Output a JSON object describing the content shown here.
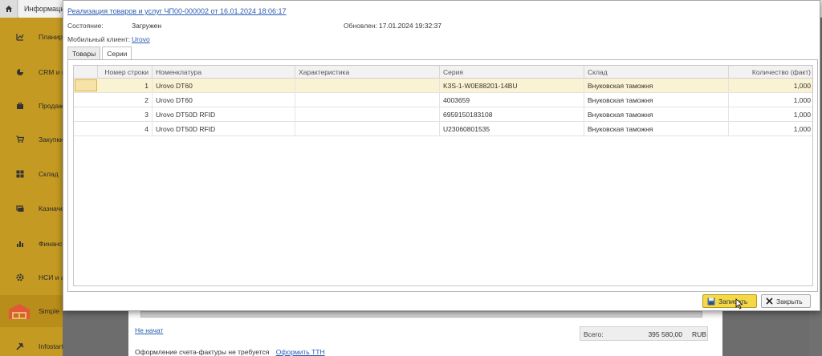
{
  "app": {
    "top_tab": "Информационная"
  },
  "sidebar": {
    "items": [
      {
        "label": "Планирование",
        "icon": "chart-edit-icon"
      },
      {
        "label": "CRM и маркетинг",
        "icon": "pie-chart-icon"
      },
      {
        "label": "Продажи",
        "icon": "briefcase-icon"
      },
      {
        "label": "Закупки",
        "icon": "cart-icon"
      },
      {
        "label": "Склад",
        "icon": "grid-icon"
      },
      {
        "label": "Казначейство",
        "icon": "money-icon"
      },
      {
        "label": "Финансовый контроль",
        "icon": "bar-chart-icon"
      },
      {
        "label": "НСИ и администрирование",
        "icon": "gear-icon"
      },
      {
        "label": "Simple",
        "icon": "warehouse-icon"
      },
      {
        "label": "Infostart Toolkit",
        "icon": "tools-icon"
      }
    ]
  },
  "modal": {
    "title": "Реализация товаров и услуг ЧП00-000002 от 16.01.2024 18:06:17",
    "state_label": "Состояние:",
    "state_value": "Загружен",
    "updated_label": "Обновлен:",
    "updated_value": "17.01.2024 19:32:37",
    "client_label": "Мобильный клиент:",
    "client_value": "Urovo",
    "tabs": [
      "Товары",
      "Серии"
    ],
    "active_tab": "Серии",
    "columns": [
      "Номер строки",
      "Номенклатура",
      "Характеристика",
      "Серия",
      "Склад",
      "Количество (факт)"
    ],
    "rows": [
      {
        "n": "1",
        "item": "Urovo DT60",
        "char": "",
        "series": "K3S-1-W0E88201-14BU",
        "warehouse": "Внуковская таможня",
        "qty": "1,000"
      },
      {
        "n": "2",
        "item": "Urovo DT60",
        "char": "",
        "series": "4003659",
        "warehouse": "Внуковская таможня",
        "qty": "1,000"
      },
      {
        "n": "3",
        "item": "Urovo DT50D RFID",
        "char": "",
        "series": "6959150183108",
        "warehouse": "Внуковская таможня",
        "qty": "1,000"
      },
      {
        "n": "4",
        "item": "Urovo DT50D RFID",
        "char": "",
        "series": "U23060801535",
        "warehouse": "Внуковская таможня",
        "qty": "1,000"
      }
    ],
    "save_label": "Записать",
    "close_label": "Закрыть"
  },
  "background": {
    "status_link": "Не начат",
    "total_label": "Всего:",
    "total_value": "395 580,00",
    "total_currency": "RUB",
    "invoice_text": "Оформление счета-фактуры не требуется",
    "ttn_link": "Оформить ТТН"
  },
  "colors": {
    "sidebar": "#c49a22",
    "accent_button": "#f4d846",
    "link": "#2a5db0",
    "selected_row": "#faf3d3"
  }
}
